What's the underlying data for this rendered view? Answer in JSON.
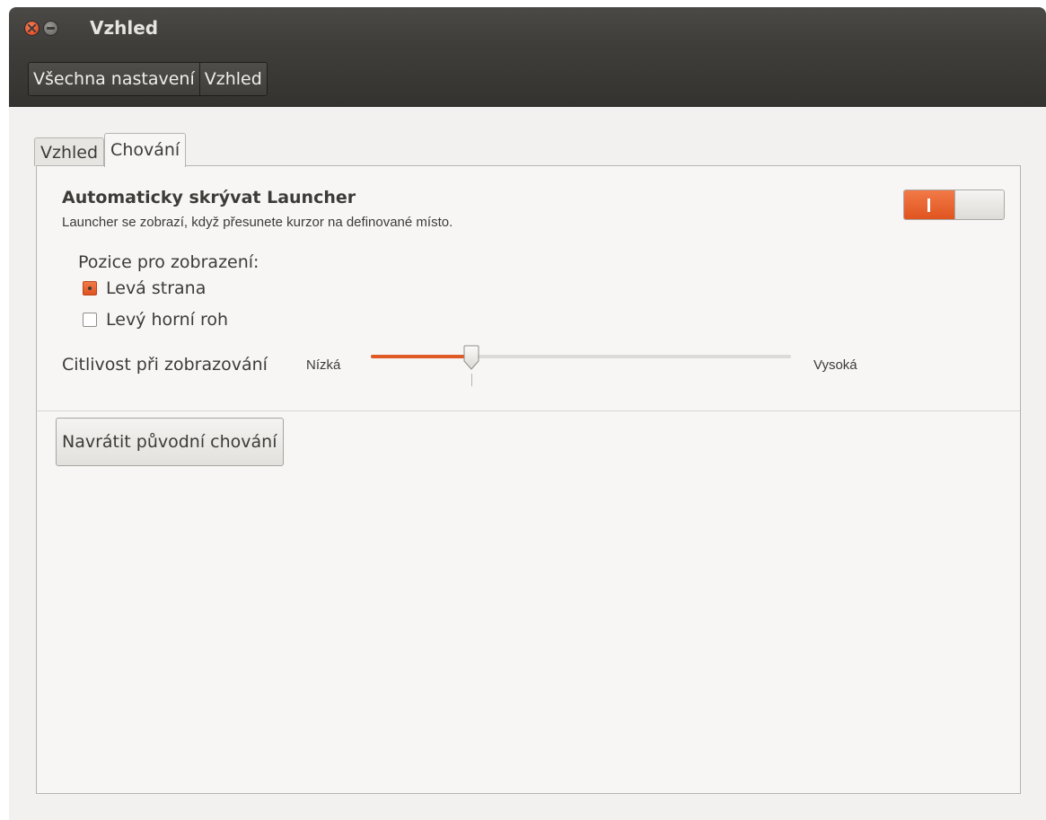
{
  "window": {
    "title": "Vzhled"
  },
  "breadcrumb": [
    "Všechna nastavení",
    "Vzhled"
  ],
  "tabs": [
    {
      "label": "Vzhled",
      "active": false
    },
    {
      "label": "Chování",
      "active": true
    }
  ],
  "behavior": {
    "autohide": {
      "title": "Automaticky skrývat Launcher",
      "description": "Launcher se zobrazí, když přesunete kurzor na definované místo.",
      "enabled": true
    },
    "reveal_position": {
      "label": "Pozice pro zobrazení:",
      "options": [
        {
          "label": "Levá strana",
          "selected": true
        },
        {
          "label": "Levý horní roh",
          "selected": false
        }
      ]
    },
    "sensitivity": {
      "label": "Citlivost při zobrazování",
      "min_label": "Nízká",
      "max_label": "Vysoká",
      "value": 0.24
    },
    "reset_label": "Navrátit původní chování"
  },
  "colors": {
    "accent": "#e05a26",
    "titlebar": "#3d3c39",
    "background": "#f2f1f0"
  },
  "icons": {
    "close": "close-icon",
    "minimize": "minimize-icon"
  }
}
